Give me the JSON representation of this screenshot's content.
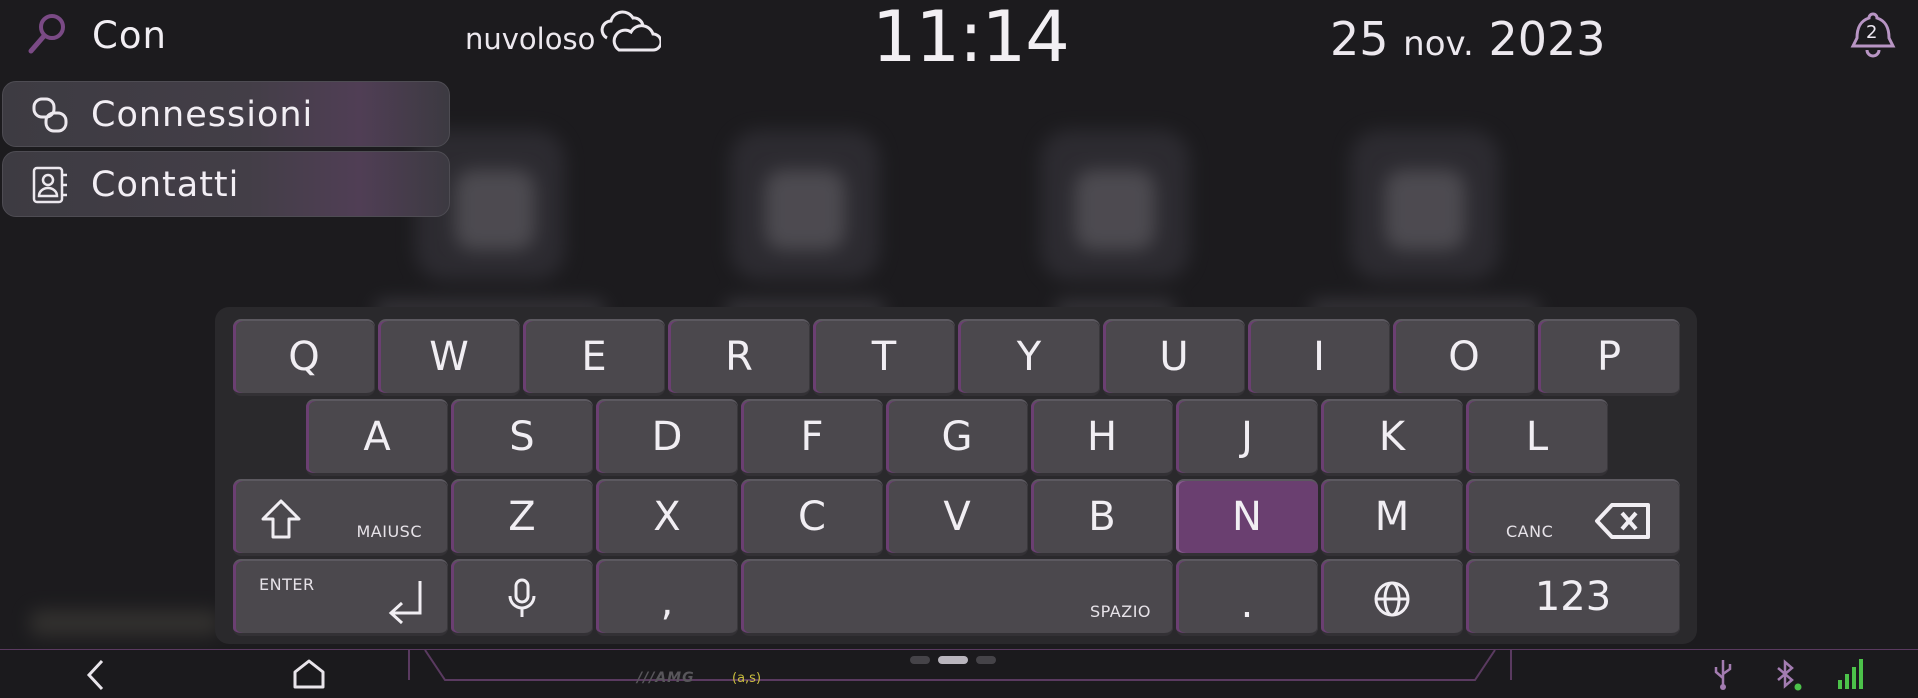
{
  "top_bar": {
    "search_query": "Con",
    "weather_text": "nuvoloso",
    "weather_icon": "cloud-icon",
    "time": "11:14",
    "date_day": "25",
    "date_month": "nov.",
    "date_year": "2023",
    "notification_count": "2"
  },
  "suggestions": [
    {
      "label": "Connessioni",
      "icon": "connections-icon"
    },
    {
      "label": "Contatti",
      "icon": "contacts-book-icon"
    }
  ],
  "keyboard": {
    "row1": [
      "Q",
      "W",
      "E",
      "R",
      "T",
      "Y",
      "U",
      "I",
      "O",
      "P"
    ],
    "row2": [
      "A",
      "S",
      "D",
      "F",
      "G",
      "H",
      "J",
      "K",
      "L"
    ],
    "row3": [
      "Z",
      "X",
      "C",
      "V",
      "B",
      "N",
      "M"
    ],
    "active_key": "N",
    "shift_label": "MAIUSC",
    "delete_label": "CANC",
    "enter_label": "ENTER",
    "comma": ",",
    "space_label": "SPAZIO",
    "period": ".",
    "numeric_label": "123"
  },
  "bottom_bar": {
    "brand": "///AMG",
    "brand_sub": "(a,s)",
    "page_count": 3,
    "active_page": 2,
    "status_icons": [
      "usb-icon",
      "bluetooth-icon",
      "signal-strength-icon"
    ]
  },
  "colors": {
    "accent": "#6a3f70",
    "background": "#1c1b1e",
    "key": "#4b484d",
    "signal_green": "#4cc24a"
  }
}
